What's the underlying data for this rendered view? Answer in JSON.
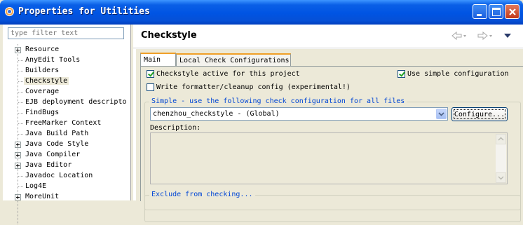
{
  "window": {
    "title": "Properties for Utilities",
    "app_icon": "gear-icon",
    "buttons": [
      "minimize-icon",
      "maximize-icon",
      "close-icon"
    ]
  },
  "filter": {
    "placeholder": "type filter text"
  },
  "tree": {
    "items": [
      {
        "label": "Resource",
        "expandable": true
      },
      {
        "label": "AnyEdit Tools",
        "expandable": false
      },
      {
        "label": "Builders",
        "expandable": false
      },
      {
        "label": "Checkstyle",
        "expandable": false,
        "selected": true
      },
      {
        "label": "Coverage",
        "expandable": false
      },
      {
        "label": "EJB deployment descripto",
        "expandable": false
      },
      {
        "label": "FindBugs",
        "expandable": false
      },
      {
        "label": "FreeMarker Context",
        "expandable": false
      },
      {
        "label": "Java Build Path",
        "expandable": false
      },
      {
        "label": "Java Code Style",
        "expandable": true
      },
      {
        "label": "Java Compiler",
        "expandable": true
      },
      {
        "label": "Java Editor",
        "expandable": true
      },
      {
        "label": "Javadoc Location",
        "expandable": false
      },
      {
        "label": "Log4E",
        "expandable": false
      },
      {
        "label": "MoreUnit",
        "expandable": true
      }
    ]
  },
  "page": {
    "title": "Checkstyle",
    "nav_icons": [
      "back-arrow-icon",
      "forward-arrow-icon",
      "view-menu-icon"
    ]
  },
  "tabs": [
    {
      "label": "Main",
      "active": true
    },
    {
      "label": "Local Check Configurations",
      "active": false
    }
  ],
  "main": {
    "checkstyle_active": {
      "label": "Checkstyle active for this project",
      "checked": true
    },
    "use_simple": {
      "label": "Use simple configuration",
      "checked": true
    },
    "write_formatter": {
      "label": "Write formatter/cleanup config (experimental!)",
      "checked": false
    },
    "simple_group": {
      "title": "Simple - use the following check configuration for all files",
      "selected_config": "chenzhou_checkstyle  - (Global)",
      "configure_label": "Configure...",
      "description_label": "Description:"
    },
    "exclude_group": {
      "title": "Exclude from checking..."
    }
  }
}
